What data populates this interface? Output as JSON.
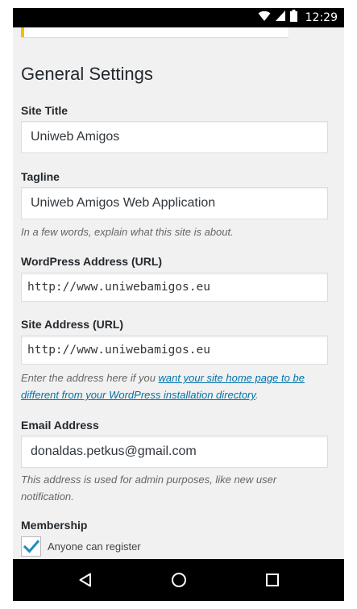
{
  "status_bar": {
    "time": "12:29",
    "icons": [
      "wifi-icon",
      "signal-icon",
      "battery-icon"
    ]
  },
  "page": {
    "title": "General Settings"
  },
  "fields": {
    "site_title": {
      "label": "Site Title",
      "value": "Uniweb Amigos"
    },
    "tagline": {
      "label": "Tagline",
      "value": "Uniweb Amigos Web Application",
      "description": "In a few words, explain what this site is about."
    },
    "wordpress_address": {
      "label": "WordPress Address (URL)",
      "value": "http://www.uniwebamigos.eu"
    },
    "site_address": {
      "label": "Site Address (URL)",
      "value": "http://www.uniwebamigos.eu",
      "description_prefix": "Enter the address here if you ",
      "description_link": "want your site home page to be different from your WordPress installation directory",
      "description_suffix": "."
    },
    "email_address": {
      "label": "Email Address",
      "value": "donaldas.petkus@gmail.com",
      "description": "This address is used for admin purposes, like new user notification."
    },
    "membership": {
      "label": "Membership",
      "checkbox_label": "Anyone can register",
      "checked": true
    }
  },
  "nav_bar": {
    "buttons": [
      "back-icon",
      "home-icon",
      "recents-icon"
    ]
  },
  "colors": {
    "accent": "#0073aa",
    "notice": "#ffb900",
    "checkmark": "#1e8cbe"
  }
}
